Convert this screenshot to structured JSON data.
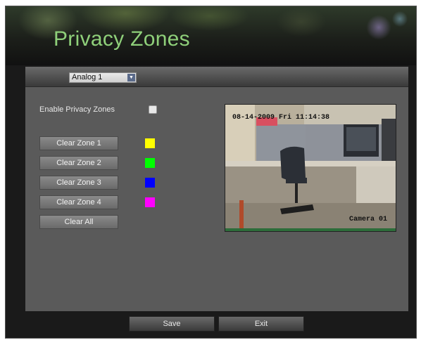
{
  "title": "Privacy Zones",
  "camera_select": {
    "value": "Analog 1"
  },
  "enable_label": "Enable Privacy Zones",
  "enable_checked": false,
  "zones": [
    {
      "label": "Clear Zone 1",
      "color": "#ffff00"
    },
    {
      "label": "Clear Zone 2",
      "color": "#00ff00"
    },
    {
      "label": "Clear Zone 3",
      "color": "#0000ff"
    },
    {
      "label": "Clear Zone 4",
      "color": "#ff00ff"
    }
  ],
  "clear_all_label": "Clear All",
  "preview": {
    "timestamp": "08-14-2009 Fri 11:14:38",
    "camera_name": "Camera 01"
  },
  "buttons": {
    "save": "Save",
    "exit": "Exit"
  }
}
